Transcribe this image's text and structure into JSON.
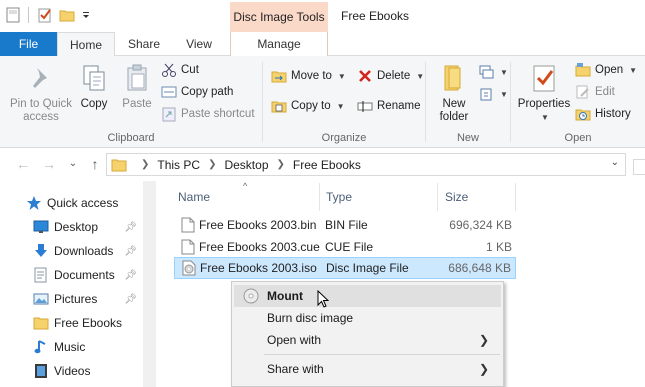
{
  "window": {
    "title": "Free Ebooks",
    "context_tab_header": "Disc Image Tools"
  },
  "qat": [
    "save-icon",
    "properties-icon",
    "new-folder-icon",
    "customize-icon"
  ],
  "tabs": {
    "file": "File",
    "home": "Home",
    "share": "Share",
    "view": "View",
    "manage": "Manage"
  },
  "ribbon": {
    "clipboard": {
      "label": "Clipboard",
      "pin": "Pin to Quick access",
      "copy": "Copy",
      "paste": "Paste",
      "cut": "Cut",
      "copy_path": "Copy path",
      "paste_shortcut": "Paste shortcut"
    },
    "organize": {
      "label": "Organize",
      "move_to": "Move to",
      "copy_to": "Copy to",
      "delete": "Delete",
      "rename": "Rename"
    },
    "new": {
      "label": "New",
      "new_folder": "New folder"
    },
    "open": {
      "label": "Open",
      "properties": "Properties",
      "open": "Open",
      "edit": "Edit",
      "history": "History"
    }
  },
  "address": {
    "crumbs": [
      "This PC",
      "Desktop",
      "Free Ebooks"
    ]
  },
  "nav": {
    "items": [
      {
        "label": "Quick access",
        "icon": "star-icon"
      },
      {
        "label": "Desktop",
        "icon": "desktop-icon",
        "pinned": true
      },
      {
        "label": "Downloads",
        "icon": "download-icon",
        "pinned": true
      },
      {
        "label": "Documents",
        "icon": "documents-icon",
        "pinned": true
      },
      {
        "label": "Pictures",
        "icon": "pictures-icon",
        "pinned": true
      },
      {
        "label": "Free Ebooks",
        "icon": "folder-icon"
      },
      {
        "label": "Music",
        "icon": "music-icon"
      },
      {
        "label": "Videos",
        "icon": "videos-icon"
      }
    ]
  },
  "columns": {
    "name": "Name",
    "type": "Type",
    "size": "Size"
  },
  "files": [
    {
      "name": "Free Ebooks 2003.bin",
      "type": "BIN File",
      "size": "696,324 KB",
      "icon": "file-icon",
      "selected": false
    },
    {
      "name": "Free Ebooks 2003.cue",
      "type": "CUE File",
      "size": "1 KB",
      "icon": "file-icon",
      "selected": false
    },
    {
      "name": "Free Ebooks 2003.iso",
      "type": "Disc Image File",
      "size": "686,648 KB",
      "icon": "disc-image-icon",
      "selected": true
    }
  ],
  "context_menu": {
    "items": [
      {
        "label": "Mount",
        "bold": true,
        "highlighted": true
      },
      {
        "label": "Burn disc image"
      },
      {
        "label": "Open with",
        "submenu": true
      },
      {
        "label": "Share with",
        "submenu": true
      }
    ]
  },
  "colors": {
    "file_tab": "#1979ca",
    "context_tab": "#fbd9c8",
    "selection": "#cce8ff",
    "folder": "#f5d26b"
  }
}
